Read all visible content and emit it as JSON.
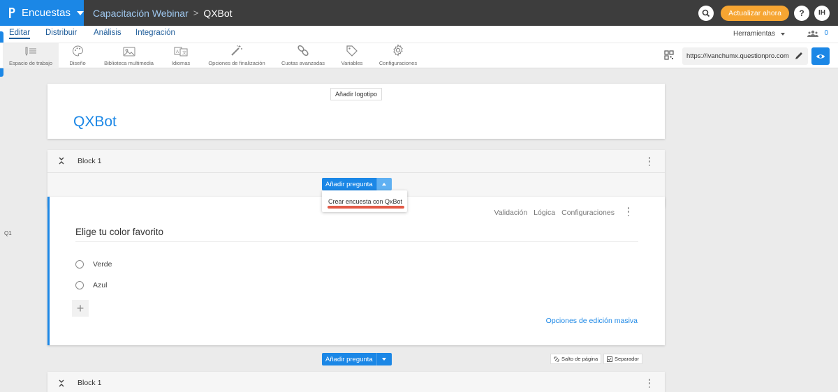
{
  "topbar": {
    "app_name": "Encuestas",
    "breadcrumb": [
      "Capacitación Webinar",
      "QXBot"
    ],
    "upgrade_label": "Actualizar ahora",
    "help_label": "?",
    "user_initials": "IH"
  },
  "nav": {
    "items": [
      "Editar",
      "Distribuir",
      "Análisis",
      "Integración"
    ],
    "active": "Editar",
    "tools_label": "Herramientas",
    "collaborators_count": "0"
  },
  "toolbar": {
    "items": [
      {
        "label": "Espacio de trabajo",
        "icon": "workspace-icon"
      },
      {
        "label": "Diseño",
        "icon": "palette-icon"
      },
      {
        "label": "Biblioteca multimedia",
        "icon": "image-icon"
      },
      {
        "label": "Idiomas",
        "icon": "translate-icon"
      },
      {
        "label": "Opciones de finalización",
        "icon": "magic-wand-icon"
      },
      {
        "label": "Cuotas avanzadas",
        "icon": "link-icon"
      },
      {
        "label": "Variables",
        "icon": "tag-icon"
      },
      {
        "label": "Configuraciones",
        "icon": "gear-icon"
      }
    ],
    "survey_url": "https://ivanchumx.questionpro.com"
  },
  "survey": {
    "add_logo_label": "Añadir logotipo",
    "title": "QXBot"
  },
  "blocks": [
    {
      "title": "Block 1"
    },
    {
      "title": "Block 1"
    }
  ],
  "add_question_label": "Añadir pregunta",
  "dropdown": {
    "items": [
      "Crear encuesta con QxBot"
    ]
  },
  "question": {
    "number": "Q1",
    "links": [
      "Validación",
      "Lógica",
      "Configuraciones"
    ],
    "text": "Elige tu color favorito",
    "options": [
      "Verde",
      "Azul"
    ],
    "bulk_edit_label": "Opciones de edición masiva"
  },
  "page_break_label": "Salto de página",
  "separator_label": "Separador",
  "colors": {
    "accent": "#1b87e6",
    "topbar": "#3d3d3d",
    "upgrade": "#f6a532",
    "highlight": "#e35a47"
  }
}
